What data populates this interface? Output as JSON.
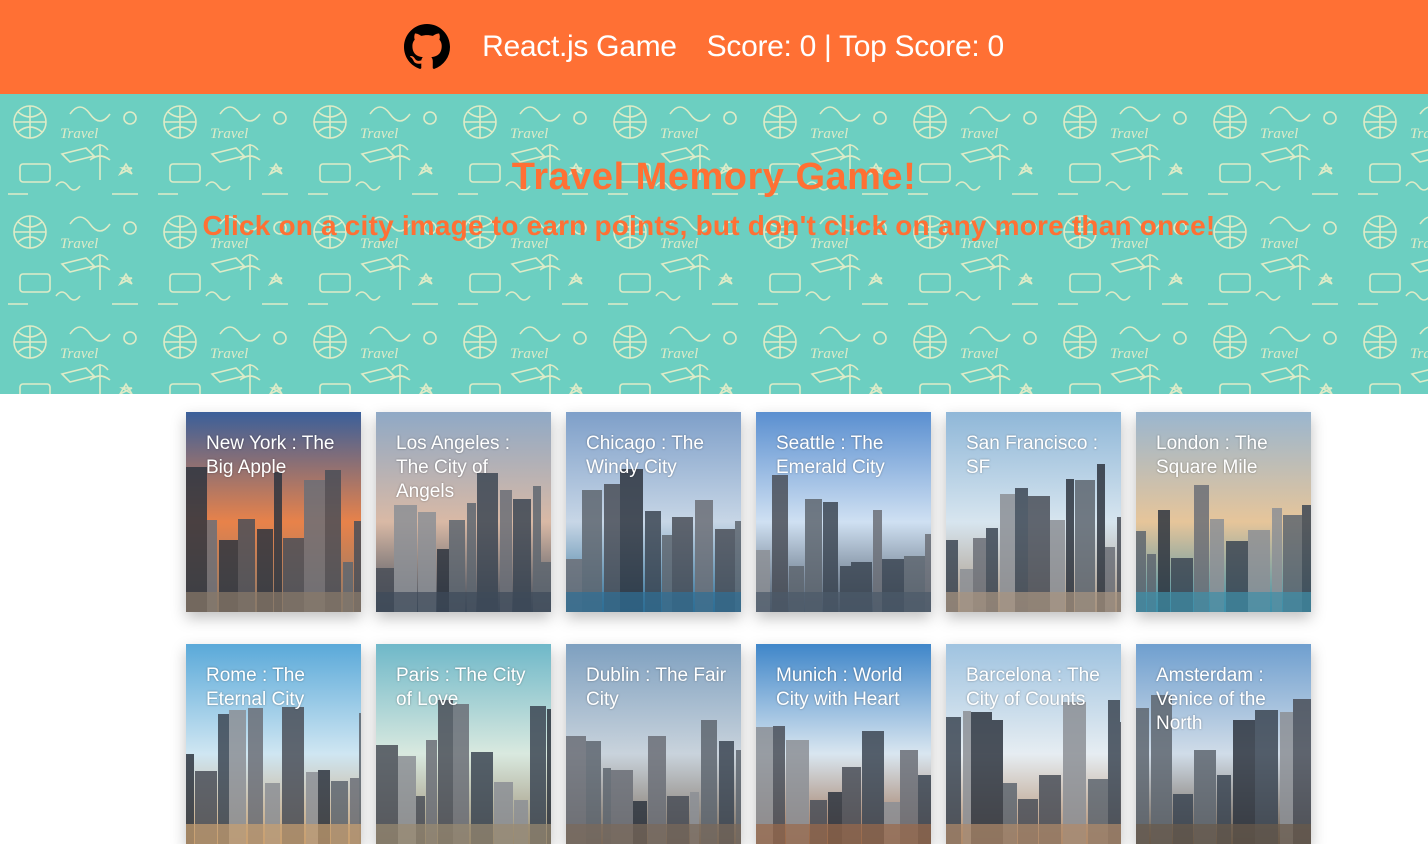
{
  "navbar": {
    "title": "React.js Game",
    "score": "Score: 0 | Top Score: 0",
    "icon": "github-icon"
  },
  "hero": {
    "title": "Travel Memory Game!",
    "subtitle": "Click on a city image to earn points, but don't click on any more than once!"
  },
  "cards": [
    {
      "label": "New York : The Big Apple",
      "sky_top": "#3a5f9a",
      "sky_bottom": "#e8824a",
      "ground": "#8a7a6a"
    },
    {
      "label": "Los Angeles : The City of Angels",
      "sky_top": "#8fa9c6",
      "sky_bottom": "#d9b9a5",
      "ground": "#3d4a5a"
    },
    {
      "label": "Chicago : The Windy City",
      "sky_top": "#7e9fc9",
      "sky_bottom": "#c7d6e6",
      "ground": "#2f6f96"
    },
    {
      "label": "Seattle : The Emerald City",
      "sky_top": "#5a8fd0",
      "sky_bottom": "#cfe0f2",
      "ground": "#4c5a6a"
    },
    {
      "label": "San Francisco : SF",
      "sky_top": "#8fb7d8",
      "sky_bottom": "#d7e5ef",
      "ground": "#a89480"
    },
    {
      "label": "London : The Square Mile",
      "sky_top": "#9ab6cf",
      "sky_bottom": "#e6c59a",
      "ground": "#3f8fa8"
    },
    {
      "label": "Rome : The Eternal City",
      "sky_top": "#5aa9d9",
      "sky_bottom": "#cfe6f2",
      "ground": "#c9a070"
    },
    {
      "label": "Paris : The City of Love",
      "sky_top": "#6fb8c9",
      "sky_bottom": "#d9e9df",
      "ground": "#9a8a70"
    },
    {
      "label": "Dublin : The Fair City",
      "sky_top": "#7ea0c0",
      "sky_bottom": "#c9d3dc",
      "ground": "#7a6a5a"
    },
    {
      "label": "Munich : World City with Heart",
      "sky_top": "#3f86c9",
      "sky_bottom": "#d9e6f0",
      "ground": "#9a6a4a"
    },
    {
      "label": "Barcelona : The City of Counts",
      "sky_top": "#9fc3e0",
      "sky_bottom": "#e6edf2",
      "ground": "#b08a6a"
    },
    {
      "label": "Amsterdam : Venice of the North",
      "sky_top": "#6f9fcf",
      "sky_bottom": "#d0dce8",
      "ground": "#6a5a4a"
    }
  ],
  "colors": {
    "accent": "#ff7034",
    "hero_bg": "#6ccfc1"
  }
}
